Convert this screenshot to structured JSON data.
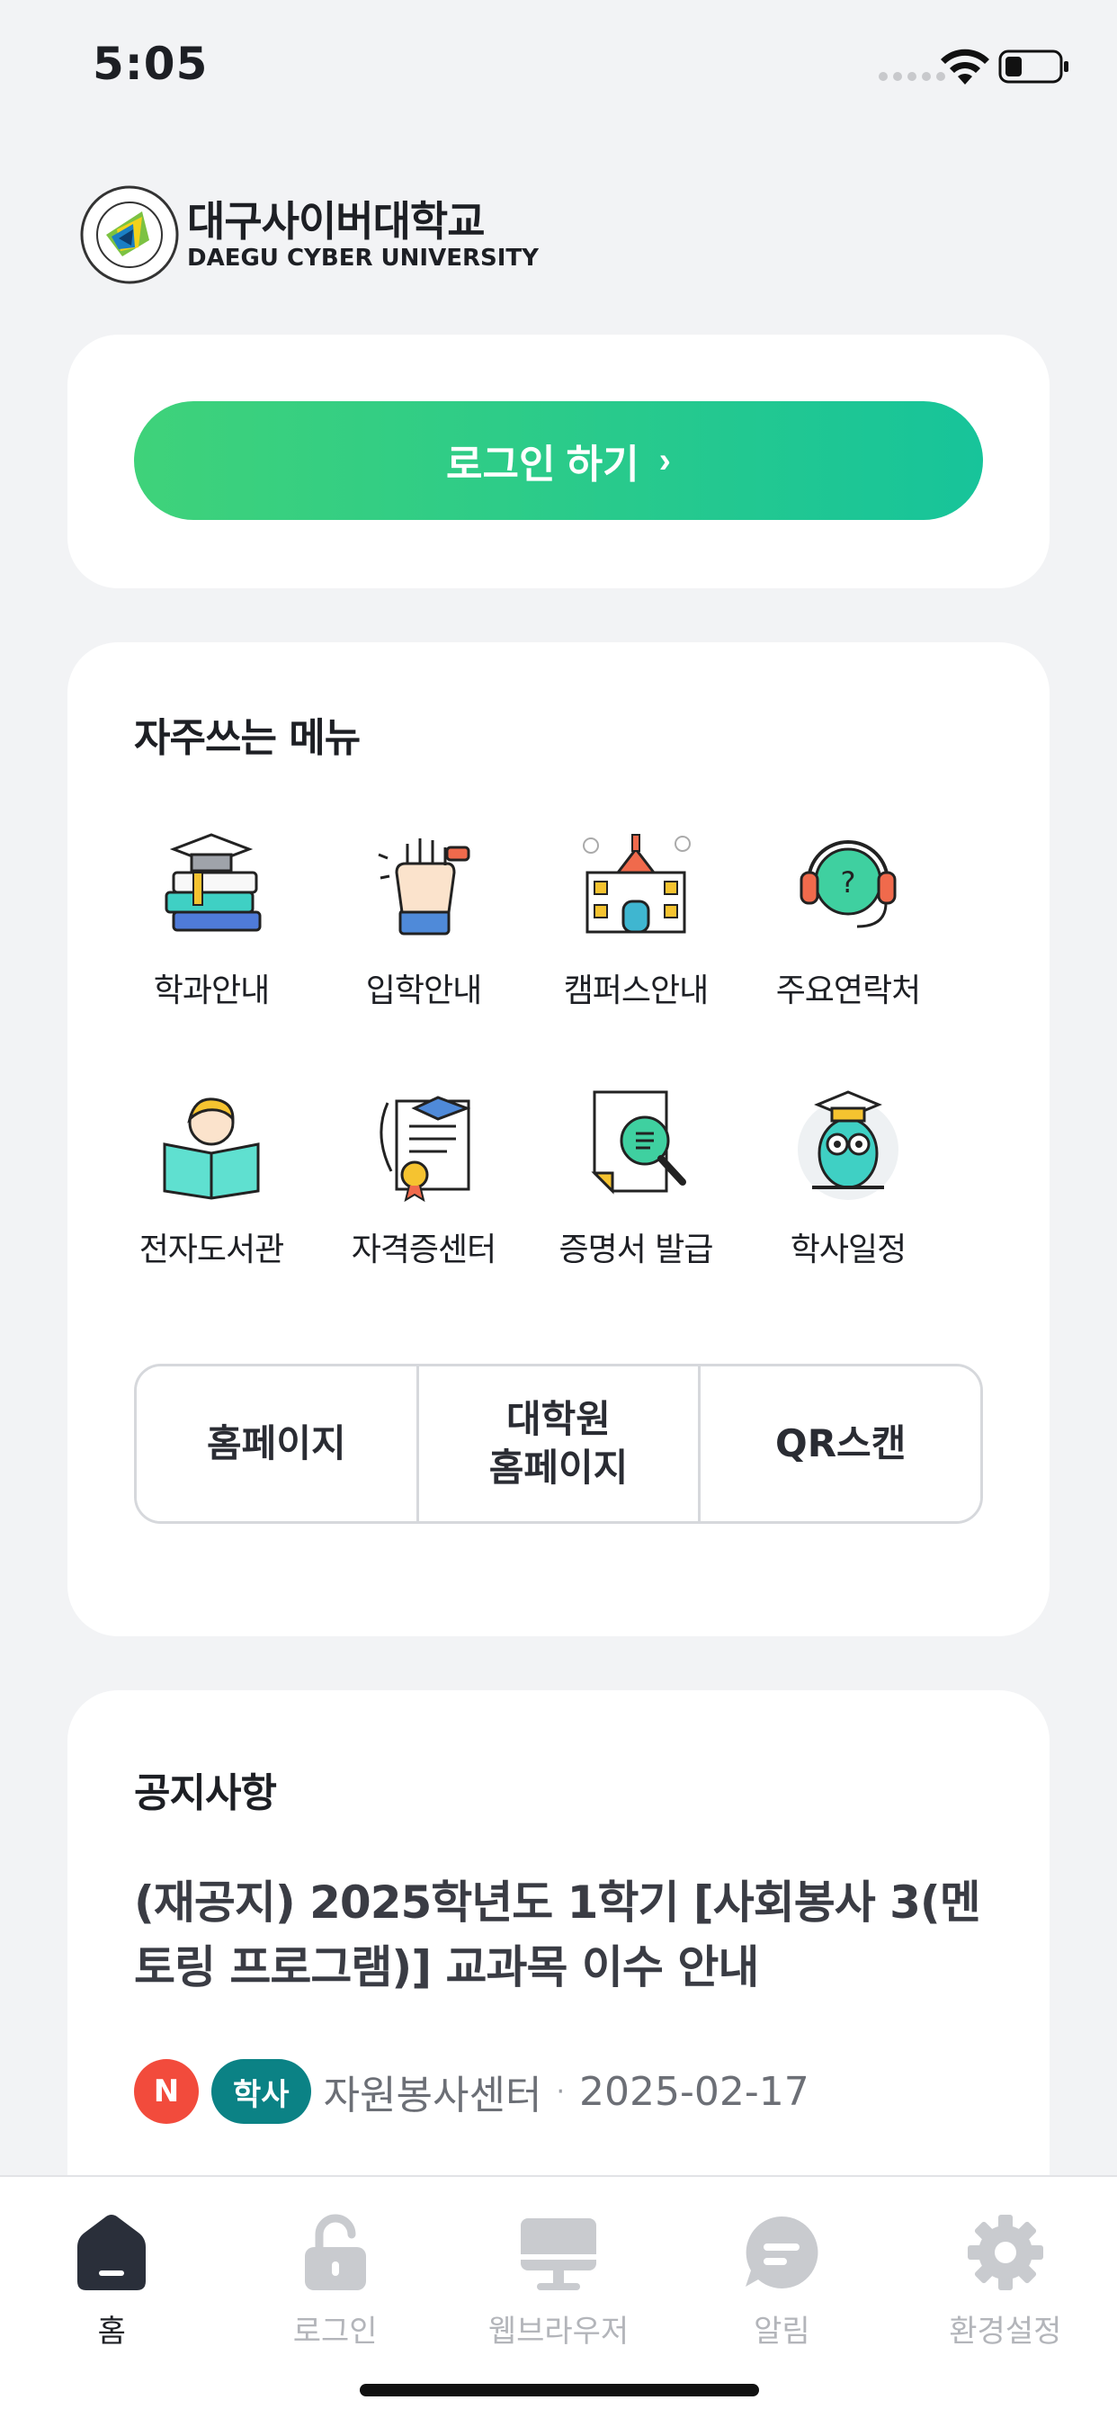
{
  "status_bar": {
    "time": "5:05",
    "icons": [
      "signal-dots",
      "wifi-icon",
      "battery-icon"
    ]
  },
  "logo": {
    "name_ko": "대구사이버대학교",
    "name_en": "DAEGU CYBER UNIVERSITY",
    "emblem_text": "대구사이버대학교 DAEGU CYBER UNIVERSITY"
  },
  "login": {
    "label": "로그인 하기",
    "chevron": "›"
  },
  "menu": {
    "title": "자주쓰는 메뉴",
    "items": [
      {
        "label": "학과안내",
        "icon": "graduation-books-icon"
      },
      {
        "label": "입학안내",
        "icon": "raised-hand-icon"
      },
      {
        "label": "캠퍼스안내",
        "icon": "campus-building-icon"
      },
      {
        "label": "주요연락처",
        "icon": "headset-icon"
      },
      {
        "label": "전자도서관",
        "icon": "reading-person-icon"
      },
      {
        "label": "자격증센터",
        "icon": "certificate-icon"
      },
      {
        "label": "증명서 발급",
        "icon": "document-search-icon"
      },
      {
        "label": "학사일정",
        "icon": "owl-icon"
      }
    ],
    "links": [
      {
        "label": "홈페이지"
      },
      {
        "label": "대학원\n홈페이지"
      },
      {
        "label": "QR스캔"
      }
    ]
  },
  "notice": {
    "title": "공지사항",
    "headline": "(재공지) 2025학년도 1학기 [사회봉사 3(멘토링 프로그램)] 교과목 이수 안내",
    "badge_new": "N",
    "category": "학사",
    "source": "자원봉사센터",
    "separator": "·",
    "date": "2025-02-17"
  },
  "tabs": [
    {
      "label": "홈",
      "icon": "home-icon",
      "active": true
    },
    {
      "label": "로그인",
      "icon": "unlock-icon",
      "active": false
    },
    {
      "label": "웹브라우저",
      "icon": "monitor-icon",
      "active": false
    },
    {
      "label": "알림",
      "icon": "message-icon",
      "active": false
    },
    {
      "label": "환경설정",
      "icon": "gear-icon",
      "active": false
    }
  ],
  "colors": {
    "accent_start": "#3fd27a",
    "accent_end": "#17c49a",
    "badge_new": "#f24b3c",
    "badge_category": "#0b8285",
    "background": "#f2f3f5"
  }
}
